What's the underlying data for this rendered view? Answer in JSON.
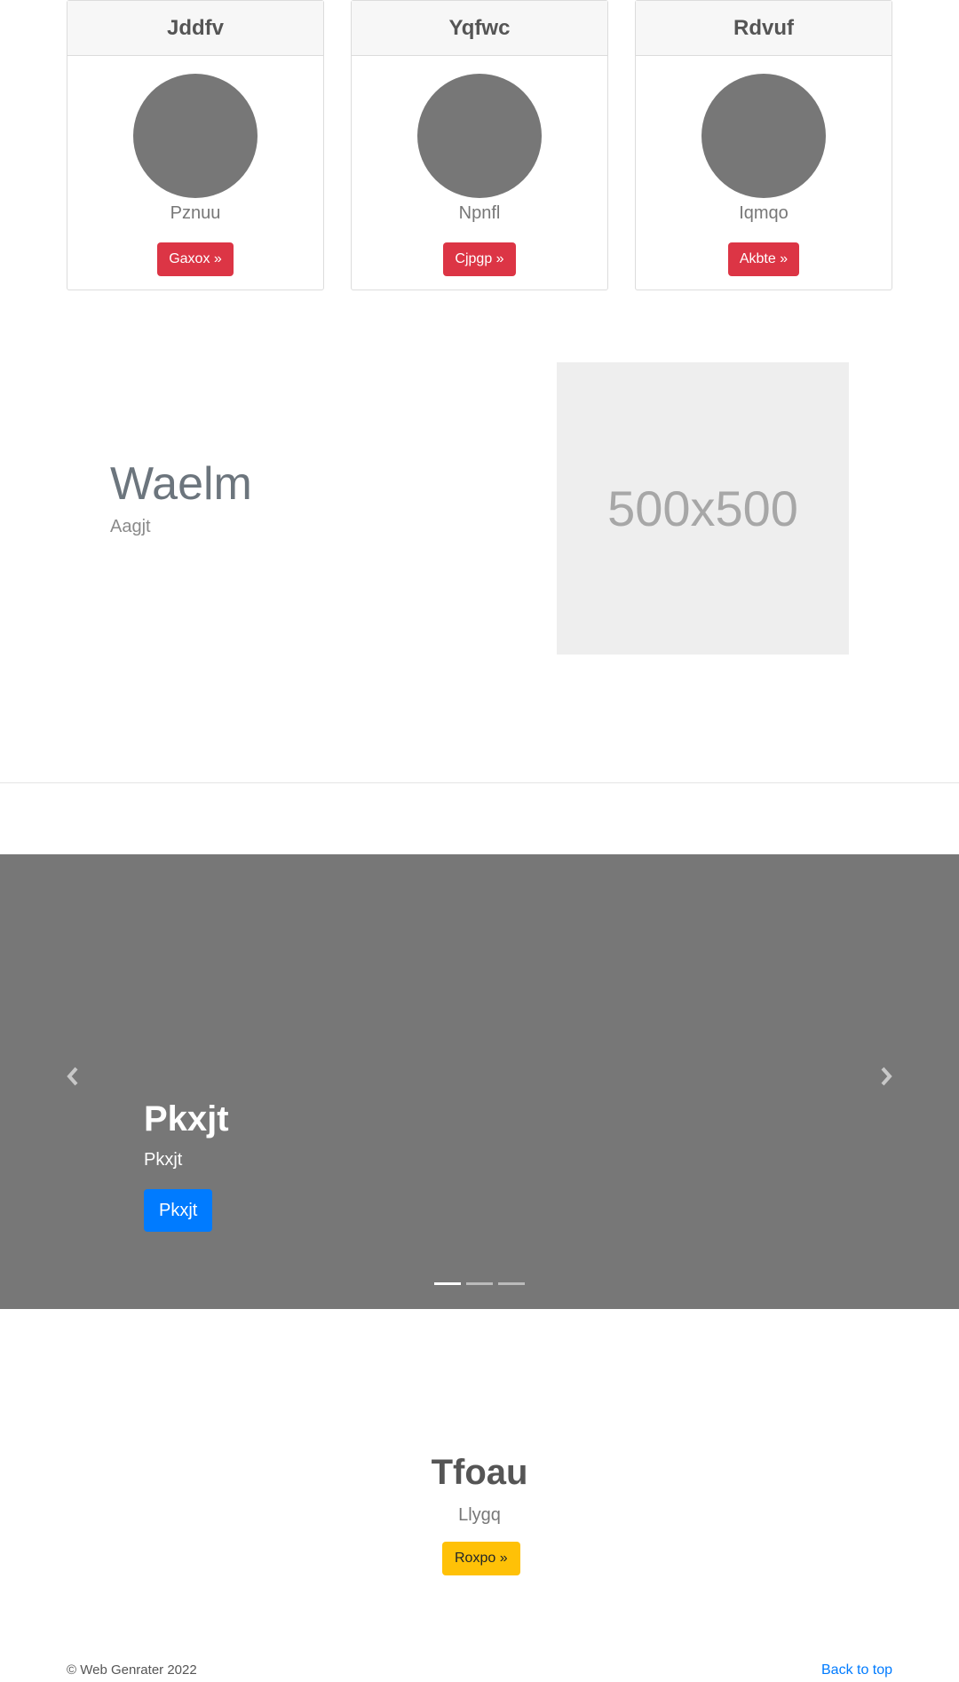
{
  "cards": [
    {
      "title": "Jddfv",
      "subtitle": "Pznuu",
      "button": "Gaxox »"
    },
    {
      "title": "Yqfwc",
      "subtitle": "Npnfl",
      "button": "Cjpgp »"
    },
    {
      "title": "Rdvuf",
      "subtitle": "Iqmqo",
      "button": "Akbte »"
    }
  ],
  "feature": {
    "title": "Waelm",
    "subtitle": "Aagjt",
    "placeholder_text": "500x500"
  },
  "carousel": {
    "title": "Pkxjt",
    "subtitle": "Pkxjt",
    "button": "Pkxjt",
    "prev_icon": "chevron-left-icon",
    "next_icon": "chevron-right-icon",
    "slide_count": 3,
    "active_index": 0,
    "background_color": "#777777"
  },
  "cta": {
    "title": "Tfoau",
    "subtitle": "Llygq",
    "button": "Roxpo »"
  },
  "footer": {
    "copyright": "© Web Genrater 2022",
    "back_to_top": "Back to top"
  },
  "colors": {
    "danger": "#dc3545",
    "primary": "#007bff",
    "warning": "#ffc107"
  }
}
